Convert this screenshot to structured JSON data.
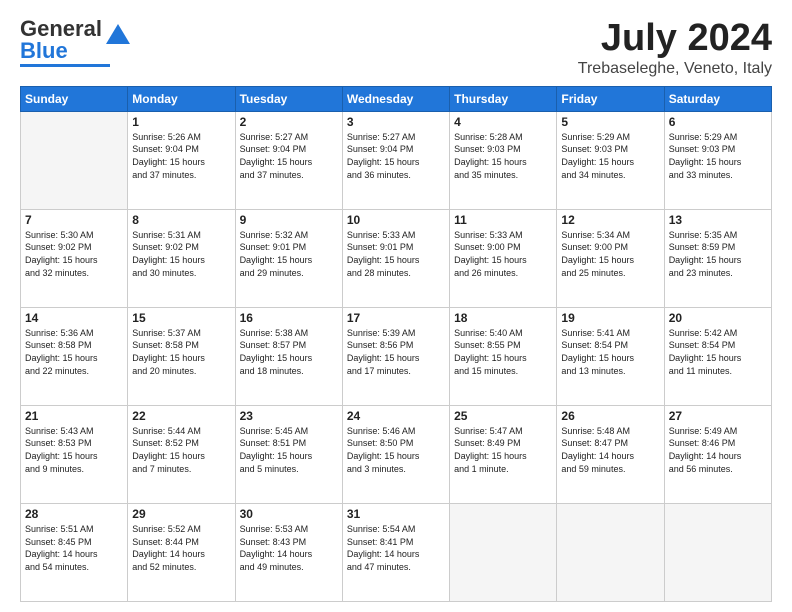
{
  "header": {
    "logo_general": "General",
    "logo_blue": "Blue",
    "title": "July 2024",
    "subtitle": "Trebaseleghe, Veneto, Italy"
  },
  "calendar": {
    "days_of_week": [
      "Sunday",
      "Monday",
      "Tuesday",
      "Wednesday",
      "Thursday",
      "Friday",
      "Saturday"
    ],
    "weeks": [
      [
        {
          "day": "",
          "info": ""
        },
        {
          "day": "1",
          "info": "Sunrise: 5:26 AM\nSunset: 9:04 PM\nDaylight: 15 hours\nand 37 minutes."
        },
        {
          "day": "2",
          "info": "Sunrise: 5:27 AM\nSunset: 9:04 PM\nDaylight: 15 hours\nand 37 minutes."
        },
        {
          "day": "3",
          "info": "Sunrise: 5:27 AM\nSunset: 9:04 PM\nDaylight: 15 hours\nand 36 minutes."
        },
        {
          "day": "4",
          "info": "Sunrise: 5:28 AM\nSunset: 9:03 PM\nDaylight: 15 hours\nand 35 minutes."
        },
        {
          "day": "5",
          "info": "Sunrise: 5:29 AM\nSunset: 9:03 PM\nDaylight: 15 hours\nand 34 minutes."
        },
        {
          "day": "6",
          "info": "Sunrise: 5:29 AM\nSunset: 9:03 PM\nDaylight: 15 hours\nand 33 minutes."
        }
      ],
      [
        {
          "day": "7",
          "info": "Sunrise: 5:30 AM\nSunset: 9:02 PM\nDaylight: 15 hours\nand 32 minutes."
        },
        {
          "day": "8",
          "info": "Sunrise: 5:31 AM\nSunset: 9:02 PM\nDaylight: 15 hours\nand 30 minutes."
        },
        {
          "day": "9",
          "info": "Sunrise: 5:32 AM\nSunset: 9:01 PM\nDaylight: 15 hours\nand 29 minutes."
        },
        {
          "day": "10",
          "info": "Sunrise: 5:33 AM\nSunset: 9:01 PM\nDaylight: 15 hours\nand 28 minutes."
        },
        {
          "day": "11",
          "info": "Sunrise: 5:33 AM\nSunset: 9:00 PM\nDaylight: 15 hours\nand 26 minutes."
        },
        {
          "day": "12",
          "info": "Sunrise: 5:34 AM\nSunset: 9:00 PM\nDaylight: 15 hours\nand 25 minutes."
        },
        {
          "day": "13",
          "info": "Sunrise: 5:35 AM\nSunset: 8:59 PM\nDaylight: 15 hours\nand 23 minutes."
        }
      ],
      [
        {
          "day": "14",
          "info": "Sunrise: 5:36 AM\nSunset: 8:58 PM\nDaylight: 15 hours\nand 22 minutes."
        },
        {
          "day": "15",
          "info": "Sunrise: 5:37 AM\nSunset: 8:58 PM\nDaylight: 15 hours\nand 20 minutes."
        },
        {
          "day": "16",
          "info": "Sunrise: 5:38 AM\nSunset: 8:57 PM\nDaylight: 15 hours\nand 18 minutes."
        },
        {
          "day": "17",
          "info": "Sunrise: 5:39 AM\nSunset: 8:56 PM\nDaylight: 15 hours\nand 17 minutes."
        },
        {
          "day": "18",
          "info": "Sunrise: 5:40 AM\nSunset: 8:55 PM\nDaylight: 15 hours\nand 15 minutes."
        },
        {
          "day": "19",
          "info": "Sunrise: 5:41 AM\nSunset: 8:54 PM\nDaylight: 15 hours\nand 13 minutes."
        },
        {
          "day": "20",
          "info": "Sunrise: 5:42 AM\nSunset: 8:54 PM\nDaylight: 15 hours\nand 11 minutes."
        }
      ],
      [
        {
          "day": "21",
          "info": "Sunrise: 5:43 AM\nSunset: 8:53 PM\nDaylight: 15 hours\nand 9 minutes."
        },
        {
          "day": "22",
          "info": "Sunrise: 5:44 AM\nSunset: 8:52 PM\nDaylight: 15 hours\nand 7 minutes."
        },
        {
          "day": "23",
          "info": "Sunrise: 5:45 AM\nSunset: 8:51 PM\nDaylight: 15 hours\nand 5 minutes."
        },
        {
          "day": "24",
          "info": "Sunrise: 5:46 AM\nSunset: 8:50 PM\nDaylight: 15 hours\nand 3 minutes."
        },
        {
          "day": "25",
          "info": "Sunrise: 5:47 AM\nSunset: 8:49 PM\nDaylight: 15 hours\nand 1 minute."
        },
        {
          "day": "26",
          "info": "Sunrise: 5:48 AM\nSunset: 8:47 PM\nDaylight: 14 hours\nand 59 minutes."
        },
        {
          "day": "27",
          "info": "Sunrise: 5:49 AM\nSunset: 8:46 PM\nDaylight: 14 hours\nand 56 minutes."
        }
      ],
      [
        {
          "day": "28",
          "info": "Sunrise: 5:51 AM\nSunset: 8:45 PM\nDaylight: 14 hours\nand 54 minutes."
        },
        {
          "day": "29",
          "info": "Sunrise: 5:52 AM\nSunset: 8:44 PM\nDaylight: 14 hours\nand 52 minutes."
        },
        {
          "day": "30",
          "info": "Sunrise: 5:53 AM\nSunset: 8:43 PM\nDaylight: 14 hours\nand 49 minutes."
        },
        {
          "day": "31",
          "info": "Sunrise: 5:54 AM\nSunset: 8:41 PM\nDaylight: 14 hours\nand 47 minutes."
        },
        {
          "day": "",
          "info": ""
        },
        {
          "day": "",
          "info": ""
        },
        {
          "day": "",
          "info": ""
        }
      ]
    ]
  }
}
